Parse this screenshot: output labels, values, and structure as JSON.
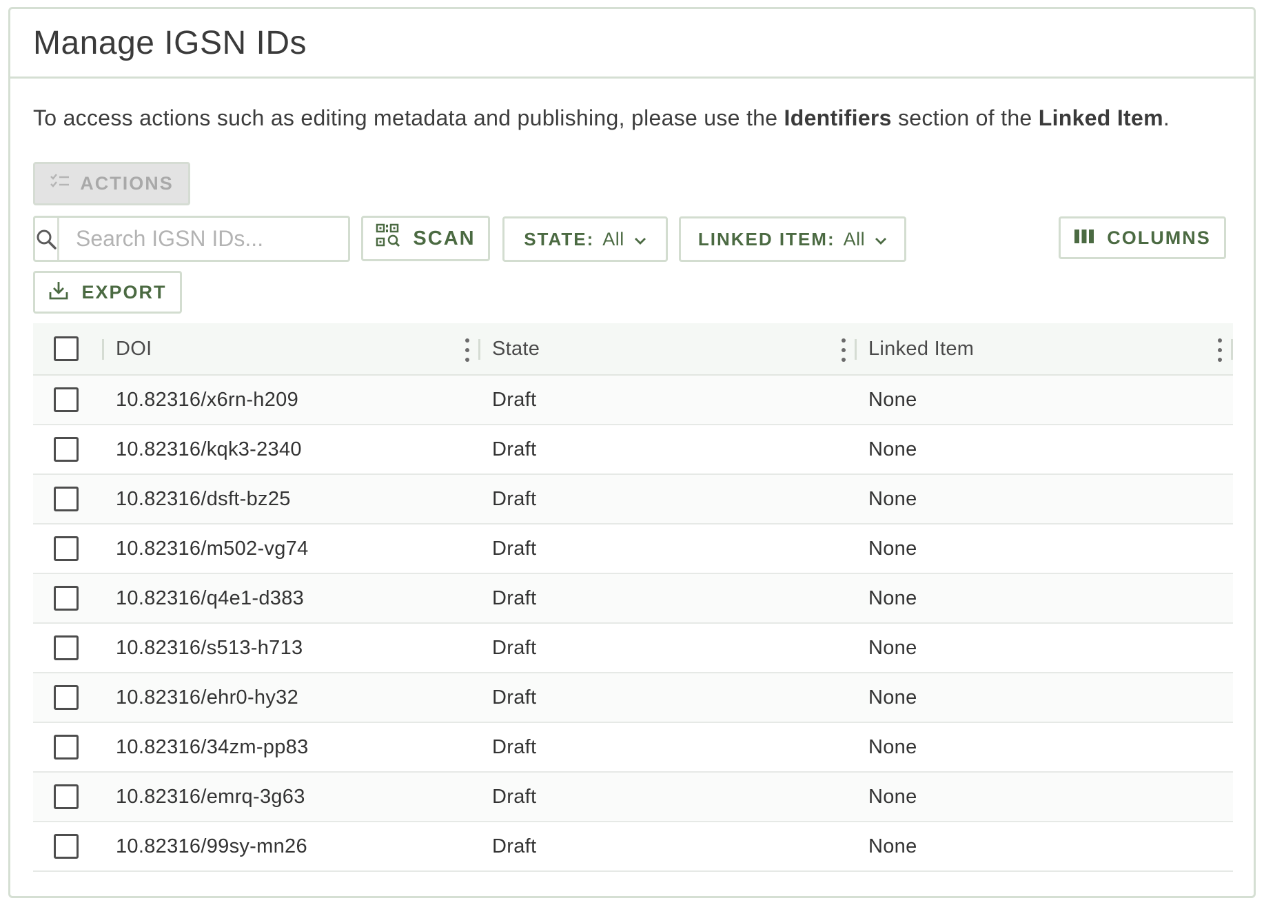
{
  "header": {
    "title": "Manage IGSN IDs"
  },
  "info": {
    "prefix": "To access actions such as editing metadata and publishing, please use the ",
    "bold1": "Identifiers",
    "middle": " section of the ",
    "bold2": "Linked Item",
    "suffix": "."
  },
  "toolbar": {
    "actions_label": "Actions",
    "search_placeholder": "Search IGSN IDs...",
    "scan_label": "Scan",
    "state_label": "State:",
    "state_value": "All",
    "linked_label": "Linked Item:",
    "linked_value": "All",
    "columns_label": "Columns",
    "export_label": "Export"
  },
  "grid": {
    "columns": [
      "DOI",
      "State",
      "Linked Item"
    ],
    "rows": [
      {
        "doi": "10.82316/x6rn-h209",
        "state": "Draft",
        "linked": "None"
      },
      {
        "doi": "10.82316/kqk3-2340",
        "state": "Draft",
        "linked": "None"
      },
      {
        "doi": "10.82316/dsft-bz25",
        "state": "Draft",
        "linked": "None"
      },
      {
        "doi": "10.82316/m502-vg74",
        "state": "Draft",
        "linked": "None"
      },
      {
        "doi": "10.82316/q4e1-d383",
        "state": "Draft",
        "linked": "None"
      },
      {
        "doi": "10.82316/s513-h713",
        "state": "Draft",
        "linked": "None"
      },
      {
        "doi": "10.82316/ehr0-hy32",
        "state": "Draft",
        "linked": "None"
      },
      {
        "doi": "10.82316/34zm-pp83",
        "state": "Draft",
        "linked": "None"
      },
      {
        "doi": "10.82316/emrq-3g63",
        "state": "Draft",
        "linked": "None"
      },
      {
        "doi": "10.82316/99sy-mn26",
        "state": "Draft",
        "linked": "None"
      }
    ]
  },
  "colors": {
    "accent": "#4b6a42",
    "border": "#d3ddd0",
    "disabled_bg": "#e3e3e3",
    "disabled_text": "#a9a9a9"
  },
  "icons": {
    "actions": "checklist-icon",
    "search": "search-icon",
    "scan": "qr-scan-icon",
    "dropdown": "chevron-down-icon",
    "columns": "columns-icon",
    "export": "download-icon",
    "column_menu": "kebab-menu-icon"
  }
}
